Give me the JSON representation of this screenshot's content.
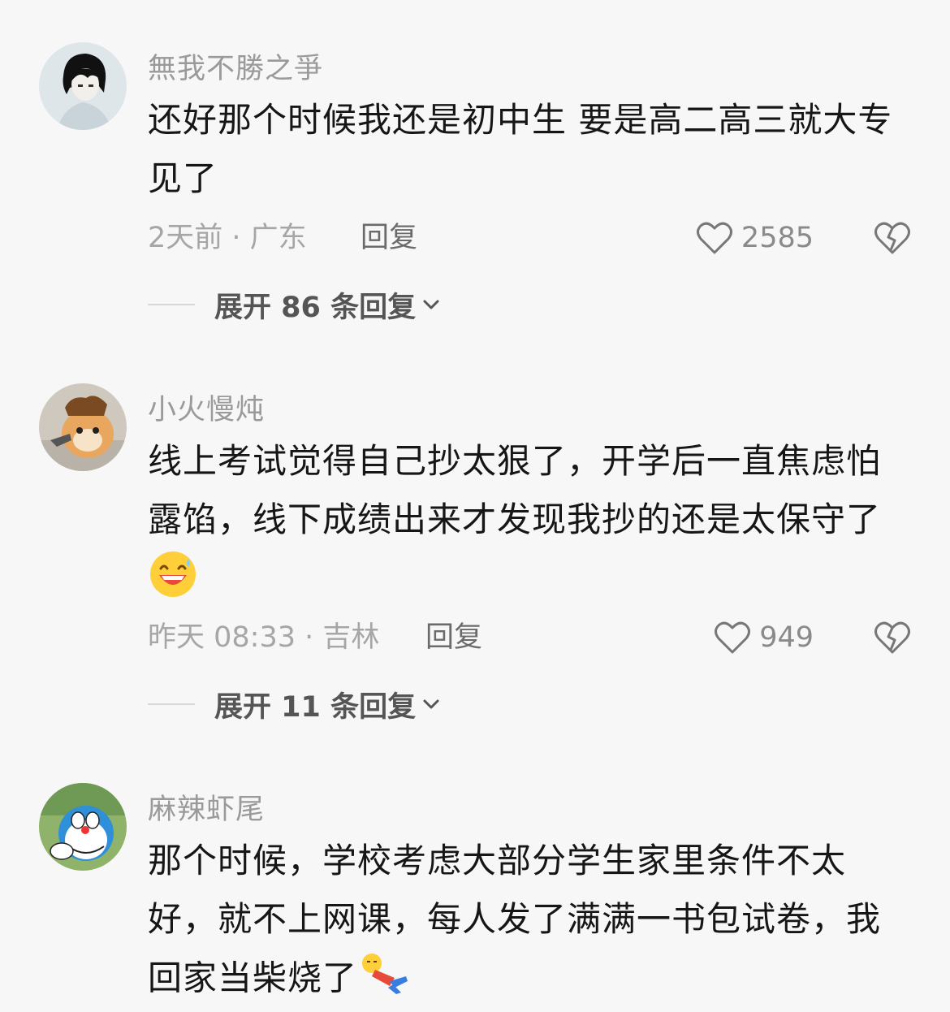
{
  "comments": [
    {
      "username": "無我不勝之爭",
      "text": "还好那个时候我还是初中生 要是高二高三就大专见了",
      "emoji": "",
      "time_location": "2天前 · 广东",
      "reply_label": "回复",
      "like_count": "2585",
      "expand_label": "展开 86 条回复",
      "avatar_icon": "anime-boy-avatar"
    },
    {
      "username": "小火慢炖",
      "text": "线上考试觉得自己抄太狠了，开学后一直焦虑怕露馅，线下成绩出来才发现我抄的还是太保守了",
      "emoji": "grinning-sweat-emoji",
      "time_location": "昨天 08:33 · 吉林",
      "reply_label": "回复",
      "like_count": "949",
      "expand_label": "展开 11 条回复",
      "avatar_icon": "cat-with-gun-avatar"
    },
    {
      "username": "麻辣虾尾",
      "text": "那个时候，学校考虑大部分学生家里条件不太好，就不上网课，每人发了满满一书包试卷，我回家当柴烧了",
      "emoji": "fallen-person-emoji",
      "avatar_icon": "doraemon-avatar"
    }
  ],
  "colors": {
    "background": "#f7f7f7",
    "text": "#161616",
    "muted": "#9a9a9a"
  }
}
